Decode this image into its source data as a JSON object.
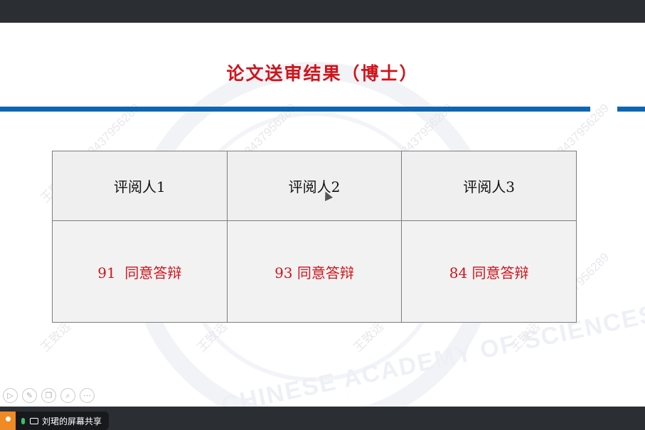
{
  "slide": {
    "title": "论文送审结果（博士）",
    "watermark_text": "王致远 +8618437956289",
    "watermark_seal_text": "CHINESE ACADEMY OF SCIENCES",
    "table": {
      "headers": [
        "评阅人1",
        "评阅人2",
        "评阅人3"
      ],
      "results": [
        "91  同意答辩",
        "93 同意答辩",
        "84 同意答辩"
      ]
    }
  },
  "bottom_bar": {
    "share_label": "刘珺的屏幕共享"
  },
  "colors": {
    "title": "#d0131b",
    "rule": "#0e66b3",
    "result_text": "#d0131b",
    "chrome": "#2b2e33"
  }
}
